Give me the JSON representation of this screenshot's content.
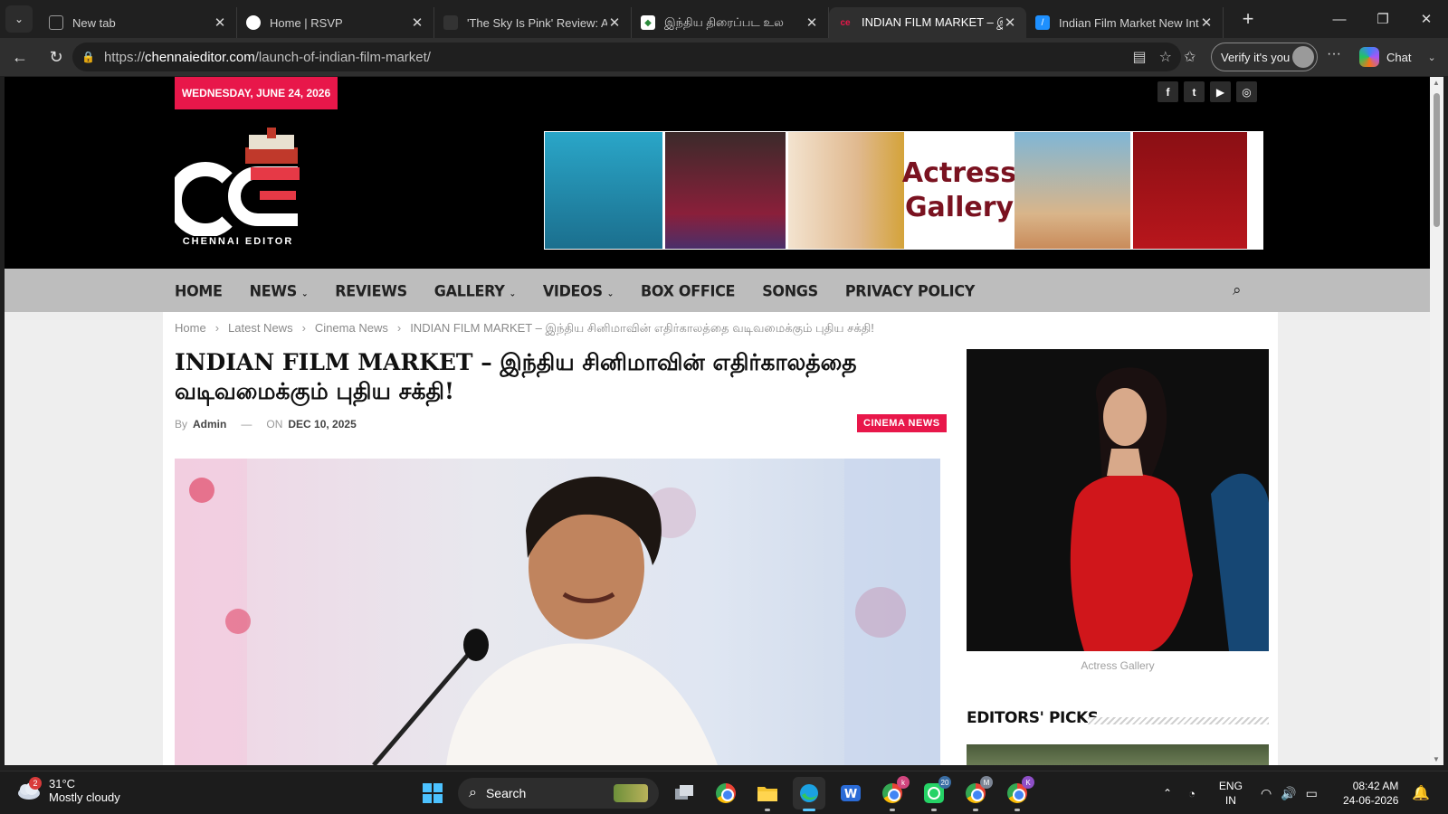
{
  "browser": {
    "tabs": [
      {
        "title": "New tab",
        "active": false
      },
      {
        "title": "Home | RSVP",
        "active": false
      },
      {
        "title": "'The Sky Is Pink' Review: A Sto",
        "active": false
      },
      {
        "title": "இந்திய திரைப்பட உல",
        "active": false
      },
      {
        "title": "INDIAN FILM MARKET – இந்",
        "active": true
      },
      {
        "title": "Indian Film Market New Intro",
        "active": false
      }
    ],
    "url_prefix": "https://",
    "url_domain": "chennaieditor.com",
    "url_path": "/launch-of-indian-film-market/",
    "verify_label": "Verify it's you",
    "chat_label": "Chat"
  },
  "site": {
    "date": "WEDNESDAY, JUNE 24, 2026",
    "logo_text": "CHENNAI EDITOR",
    "banner_text_line1": "Actress",
    "banner_text_line2": "Gallery",
    "nav": [
      {
        "label": "HOME",
        "dropdown": false
      },
      {
        "label": "NEWS",
        "dropdown": true
      },
      {
        "label": "REVIEWS",
        "dropdown": false
      },
      {
        "label": "GALLERY",
        "dropdown": true
      },
      {
        "label": "VIDEOS",
        "dropdown": true
      },
      {
        "label": "BOX OFFICE",
        "dropdown": false
      },
      {
        "label": "SONGS",
        "dropdown": false
      },
      {
        "label": "PRIVACY POLICY",
        "dropdown": false
      }
    ],
    "social_icons": [
      "facebook-icon",
      "twitter-icon",
      "youtube-icon",
      "instagram-icon"
    ]
  },
  "article": {
    "breadcrumbs": [
      "Home",
      "Latest News",
      "Cinema News",
      "INDIAN FILM MARKET – இந்திய சினிமாவின் எதிர்காலத்தை வடிவமைக்கும் புதிய சக்தி!"
    ],
    "headline_line1": "INDIAN FILM MARKET – இந்திய சினிமாவின் எதிர்காலத்தை",
    "headline_line2": "வடிவமைக்கும் புதிய சக்தி!",
    "by_label": "By",
    "author": "Admin",
    "on_label": "ON",
    "date": "DEC 10, 2025",
    "category": "CINEMA NEWS"
  },
  "sidebar": {
    "ad_caption": "Actress Gallery",
    "editors_picks_title": "EDITORS' PICKS"
  },
  "taskbar": {
    "weather_temp": "31°C",
    "weather_desc": "Mostly cloudy",
    "weather_badge": "2",
    "search_label": "Search",
    "lang_line1": "ENG",
    "lang_line2": "IN",
    "time": "08:42 AM",
    "date": "24-06-2026",
    "whatsapp_badge": "20",
    "chrome_badges": [
      "k",
      "M",
      "K"
    ]
  },
  "colors": {
    "accent": "#e8174a",
    "header_bg": "#000000",
    "nav_bg": "#bdbdbd"
  }
}
